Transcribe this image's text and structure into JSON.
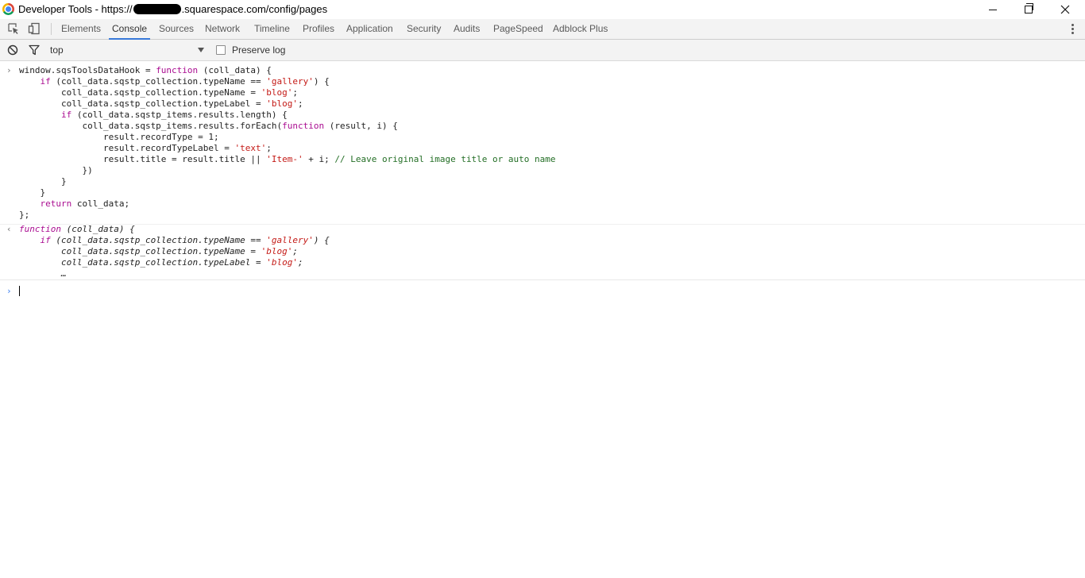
{
  "window": {
    "title_prefix": "Developer Tools - https://",
    "title_suffix": ".squarespace.com/config/pages"
  },
  "tabs": [
    {
      "label": "Elements"
    },
    {
      "label": "Console"
    },
    {
      "label": "Sources"
    },
    {
      "label": "Network"
    },
    {
      "label": "Timeline"
    },
    {
      "label": "Profiles"
    },
    {
      "label": "Application"
    },
    {
      "label": "Security"
    },
    {
      "label": "Audits"
    },
    {
      "label": "PageSpeed"
    },
    {
      "label": "Adblock Plus"
    }
  ],
  "active_tab": "Console",
  "toolbar": {
    "context": "top",
    "preserve_log_label": "Preserve log",
    "preserve_log_checked": false
  },
  "console": {
    "input": [
      [
        [
          "window.sqsToolsDataHook = ",
          ""
        ],
        [
          "function",
          "kw"
        ],
        [
          " (coll_data) {",
          ""
        ]
      ],
      [
        [
          "    ",
          ""
        ],
        [
          "if",
          "kw"
        ],
        [
          " (coll_data.sqstp_collection.typeName == ",
          ""
        ],
        [
          "'gallery'",
          "str"
        ],
        [
          ") {",
          ""
        ]
      ],
      [
        [
          "        coll_data.sqstp_collection.typeName = ",
          ""
        ],
        [
          "'blog'",
          "str"
        ],
        [
          ";",
          ""
        ]
      ],
      [
        [
          "        coll_data.sqstp_collection.typeLabel = ",
          ""
        ],
        [
          "'blog'",
          "str"
        ],
        [
          ";",
          ""
        ]
      ],
      [
        [
          "        ",
          ""
        ],
        [
          "if",
          "kw"
        ],
        [
          " (coll_data.sqstp_items.results.length) {",
          ""
        ]
      ],
      [
        [
          "            coll_data.sqstp_items.results.forEach(",
          ""
        ],
        [
          "function",
          "kw"
        ],
        [
          " (result, i) {",
          ""
        ]
      ],
      [
        [
          "                result.recordType = 1;",
          ""
        ]
      ],
      [
        [
          "                result.recordTypeLabel = ",
          ""
        ],
        [
          "'text'",
          "str"
        ],
        [
          ";",
          ""
        ]
      ],
      [
        [
          "                result.title = result.title || ",
          ""
        ],
        [
          "'Item-'",
          "str"
        ],
        [
          " + i; ",
          ""
        ],
        [
          "// Leave original image title or auto name",
          "cmt"
        ]
      ],
      [
        [
          "            })",
          ""
        ]
      ],
      [
        [
          "        }",
          ""
        ]
      ],
      [
        [
          "    }",
          ""
        ]
      ],
      [
        [
          "    ",
          ""
        ],
        [
          "return",
          "kw"
        ],
        [
          " coll_data;",
          ""
        ]
      ],
      [
        [
          "};",
          ""
        ]
      ]
    ],
    "result": [
      [
        [
          "function",
          "kw"
        ],
        [
          " (coll_data) {",
          ""
        ]
      ],
      [
        [
          "    ",
          ""
        ],
        [
          "if",
          "kw"
        ],
        [
          " (coll_data.sqstp_collection.typeName == ",
          ""
        ],
        [
          "'gallery'",
          "str"
        ],
        [
          ") {",
          ""
        ]
      ],
      [
        [
          "        coll_data.sqstp_collection.typeName = ",
          ""
        ],
        [
          "'blog'",
          "str"
        ],
        [
          ";",
          ""
        ]
      ],
      [
        [
          "        coll_data.sqstp_collection.typeLabel = ",
          ""
        ],
        [
          "'blog'",
          "str"
        ],
        [
          ";",
          ""
        ]
      ],
      [
        [
          "        …",
          ""
        ]
      ]
    ],
    "input_prompt": "›",
    "result_prompt": "‹"
  }
}
